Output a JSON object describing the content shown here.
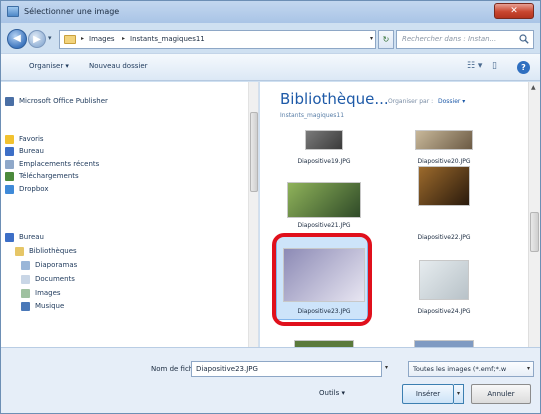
{
  "window": {
    "title": "Sélectionner une image",
    "close_label": "✕"
  },
  "address": {
    "crumbs": [
      "Images",
      "Instants_magiques11"
    ],
    "search_placeholder": "Rechercher dans : Instan..."
  },
  "toolbar": {
    "organize": "Organiser ▾",
    "new_folder": "Nouveau dossier",
    "help": "?"
  },
  "sidebar": {
    "items": [
      {
        "label": "Microsoft Office Publisher",
        "icon": "publisher-icon",
        "color": "#4a6fa5"
      },
      {
        "label": "Favoris",
        "icon": "star-icon",
        "color": "#f2c230"
      },
      {
        "label": "Bureau",
        "icon": "desktop-icon",
        "color": "#3d6fc7"
      },
      {
        "label": "Emplacements récents",
        "icon": "recent-places-icon",
        "color": "#8fa8c9"
      },
      {
        "label": "Téléchargements",
        "icon": "downloads-icon",
        "color": "#4b8a3c"
      },
      {
        "label": "Dropbox",
        "icon": "dropbox-icon",
        "color": "#3f8ad8"
      },
      {
        "label": "Bureau",
        "icon": "desktop-icon",
        "color": "#3d6fc7"
      },
      {
        "label": "Bibliothèques",
        "icon": "libraries-icon",
        "color": "#e6c667"
      },
      {
        "label": "Diaporamas",
        "icon": "slideshow-icon",
        "color": "#9ab6d8"
      },
      {
        "label": "Documents",
        "icon": "documents-icon",
        "color": "#c9d6e6"
      },
      {
        "label": "Images",
        "icon": "pictures-icon",
        "color": "#9fc1a0"
      },
      {
        "label": "Musique",
        "icon": "music-icon",
        "color": "#4a78b8"
      }
    ]
  },
  "library": {
    "title": "Bibliothèque...",
    "subtitle": "Instants_magiques11",
    "arrange_label": "Organiser par :",
    "arrange_value": "Dossier ▾"
  },
  "files": [
    {
      "name": "Diapositive19.JPG",
      "colors": [
        "#7a7a7a",
        "#3a3a3a"
      ]
    },
    {
      "name": "Diapositive20.JPG",
      "colors": [
        "#c8b89a",
        "#6b5a44"
      ]
    },
    {
      "name": "Diapositive21.JPG",
      "colors": [
        "#8fb35a",
        "#2f4a28"
      ]
    },
    {
      "name": "Diapositive22.JPG",
      "colors": [
        "#9c6a2c",
        "#2a1a0c"
      ]
    },
    {
      "name": "Diapositive23.JPG",
      "colors": [
        "#8c8ab5",
        "#e8e6f2"
      ]
    },
    {
      "name": "Diapositive24.JPG",
      "colors": [
        "#e6ecef",
        "#b8c2c8"
      ]
    }
  ],
  "bottom": {
    "filename_label": "Nom de fichier :",
    "filename_value": "Diapositive23.JPG",
    "filter_value": "Toutes les images (*.emf;*.w",
    "tools_label": "Outils",
    "open_label": "Insérer",
    "cancel_label": "Annuler"
  },
  "colors": {
    "accent": "#1e5aa8",
    "highlight_ring": "#e0101c",
    "selection": "#cde4fa"
  }
}
